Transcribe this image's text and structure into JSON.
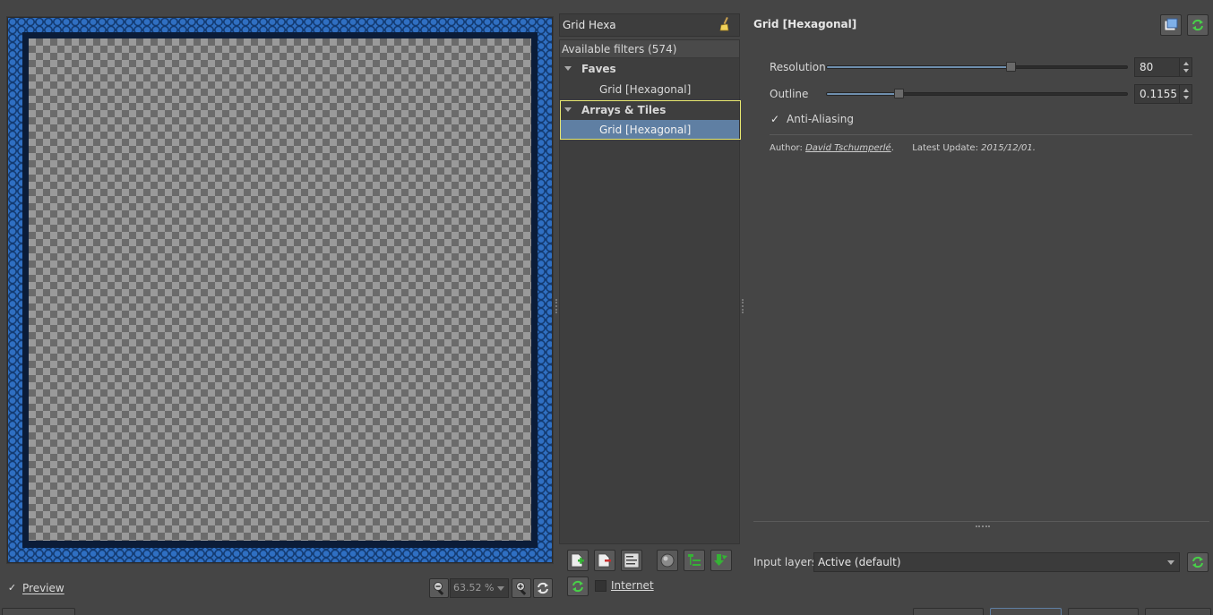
{
  "preview": {
    "checkbox_mark": "✓",
    "label": "Preview",
    "zoom_value": "63.52 %",
    "zoom_out_icon": "zoom-out-icon",
    "zoom_in_icon": "zoom-in-icon",
    "refresh_icon": "refresh-icon"
  },
  "search": {
    "value": "Grid Hexa",
    "clear_icon": "broom-icon"
  },
  "filters": {
    "header": "Available filters (574)",
    "tree": [
      {
        "label": "Faves",
        "type": "folder"
      },
      {
        "label": "Grid [Hexagonal]",
        "type": "item"
      },
      {
        "label": "Arrays & Tiles",
        "type": "folder"
      },
      {
        "label": "Grid [Hexagonal]",
        "type": "item",
        "selected": true
      }
    ]
  },
  "filter_toolbar": {
    "internet_label": "Internet",
    "icons": [
      "add-fave-icon",
      "remove-fave-icon",
      "rename-fave-icon",
      "visibility-icon",
      "tree-icon",
      "download-icon",
      "refresh-icon"
    ]
  },
  "settings": {
    "title": "Grid [Hexagonal]",
    "params": [
      {
        "label": "Resolution",
        "value": "80",
        "fraction": 0.61
      },
      {
        "label": "Outline",
        "value": "0.1155",
        "fraction": 0.24
      }
    ],
    "antialiasing": {
      "checked": true,
      "mark": "✓",
      "label": "Anti-Aliasing"
    },
    "author_label": "Author:",
    "author_name": "David Tschumperlé",
    "author_suffix": ".",
    "update_label": "Latest Update:",
    "update_value": "2015/12/01."
  },
  "input_layers": {
    "label": "Input layers",
    "value": "Active (default)"
  },
  "colors": {
    "accent": "#6f8fae",
    "selection": "#5f7fa3",
    "highlight_border": "#e8e870",
    "green_icon": "#5fd65f"
  }
}
